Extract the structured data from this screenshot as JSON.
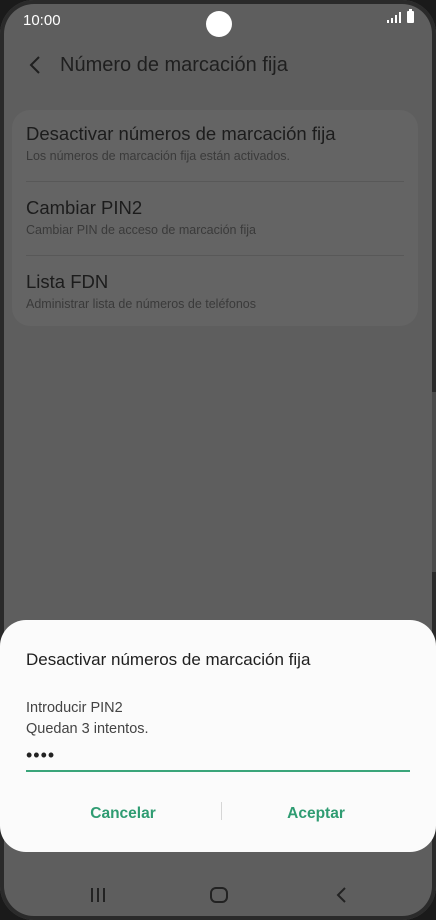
{
  "status": {
    "time": "10:00"
  },
  "appbar": {
    "title": "Número de marcación fija"
  },
  "settings": {
    "items": [
      {
        "title": "Desactivar números de marcación fija",
        "subtitle": "Los números de marcación fija están activados."
      },
      {
        "title": "Cambiar PIN2",
        "subtitle": "Cambiar PIN de acceso de marcación fija"
      },
      {
        "title": "Lista FDN",
        "subtitle": "Administrar lista de números de teléfonos"
      }
    ]
  },
  "dialog": {
    "title": "Desactivar números de marcación fija",
    "label": "Introducir PIN2",
    "attempts": "Quedan 3 intentos.",
    "pin_value": "••••",
    "cancel_label": "Cancelar",
    "accept_label": "Aceptar"
  },
  "icons": {
    "back": "chevron-left-icon",
    "signal": "signal-icon",
    "battery": "battery-icon",
    "nav_recents": "recents-icon",
    "nav_home": "home-icon",
    "nav_back": "back-icon"
  },
  "colors": {
    "accent": "#2f9c72",
    "scrim_background": "#5e5e5e",
    "dialog_background": "#fbfbfb"
  }
}
